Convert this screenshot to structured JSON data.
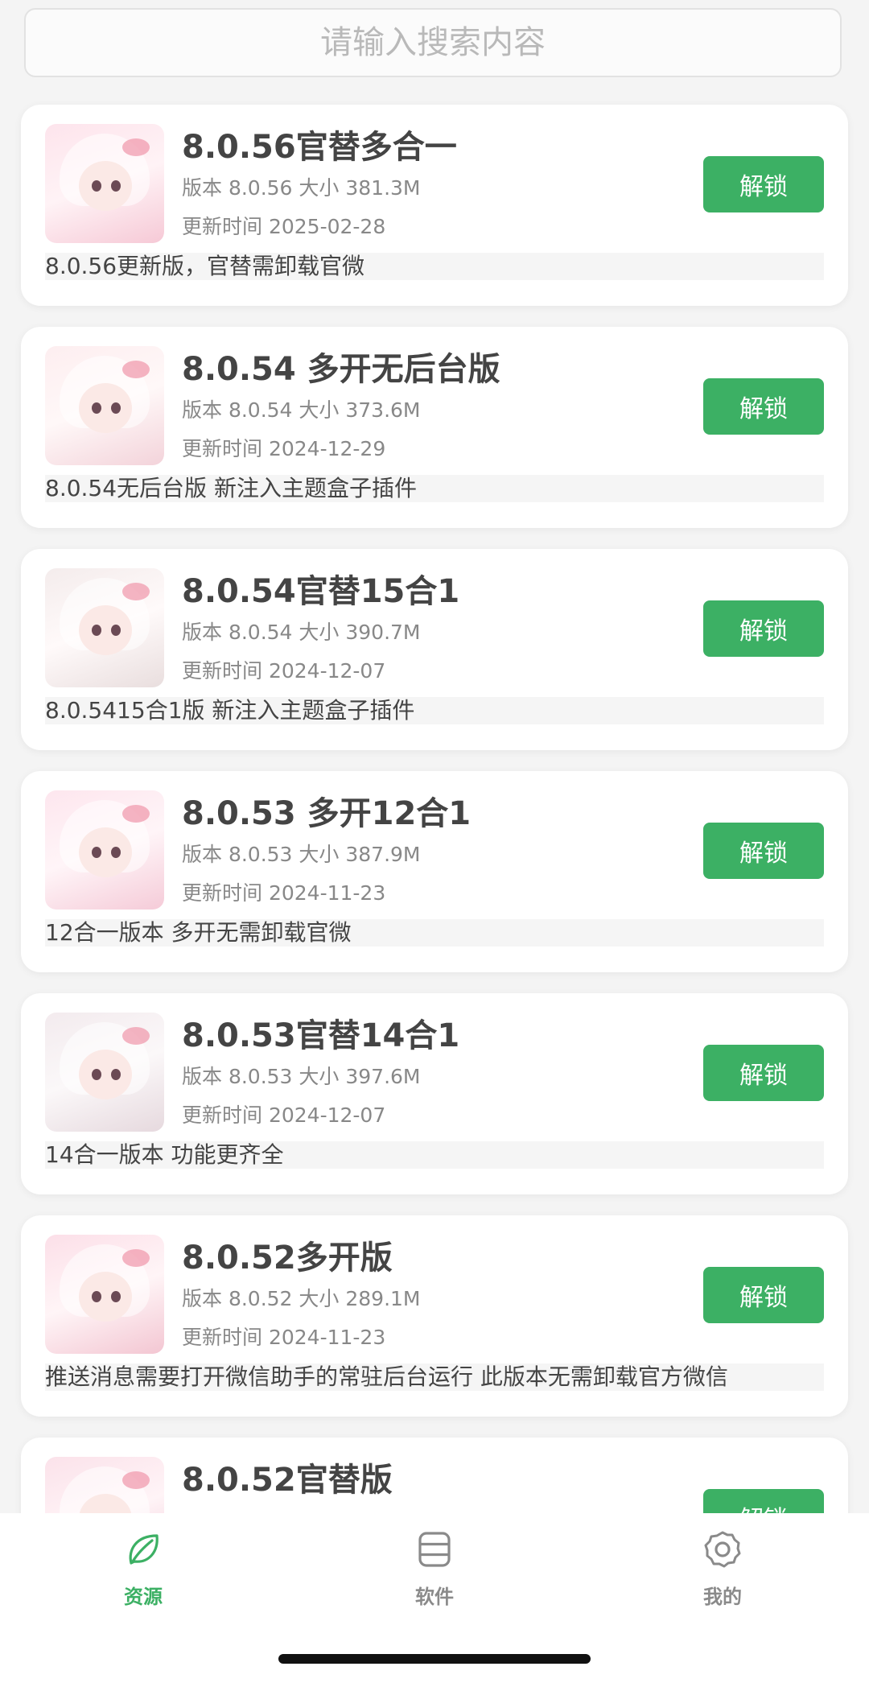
{
  "search": {
    "placeholder": "请输入搜索内容"
  },
  "items": [
    {
      "title": "8.0.56官替多合一",
      "meta": "版本 8.0.56 大小 381.3M",
      "updated": "更新时间 2025-02-28",
      "button": "解锁",
      "desc": "8.0.56更新版，官替需卸载官微"
    },
    {
      "title": "8.0.54 多开无后台版",
      "meta": "版本 8.0.54 大小 373.6M",
      "updated": "更新时间 2024-12-29",
      "button": "解锁",
      "desc": "8.0.54无后台版 新注入主题盒子插件"
    },
    {
      "title": "8.0.54官替15合1",
      "meta": "版本 8.0.54 大小 390.7M",
      "updated": "更新时间 2024-12-07",
      "button": "解锁",
      "desc": "8.0.5415合1版 新注入主题盒子插件"
    },
    {
      "title": "8.0.53 多开12合1",
      "meta": "版本 8.0.53 大小 387.9M",
      "updated": "更新时间 2024-11-23",
      "button": "解锁",
      "desc": "12合一版本 多开无需卸载官微"
    },
    {
      "title": "8.0.53官替14合1",
      "meta": "版本 8.0.53 大小 397.6M",
      "updated": "更新时间 2024-12-07",
      "button": "解锁",
      "desc": "14合一版本 功能更齐全"
    },
    {
      "title": "8.0.52多开版",
      "meta": "版本 8.0.52 大小 289.1M",
      "updated": "更新时间 2024-11-23",
      "button": "解锁",
      "desc": "推送消息需要打开微信助手的常驻后台运行 此版本无需卸载官方微信"
    },
    {
      "title": "8.0.52官替版",
      "meta": "",
      "updated": "",
      "button": "解锁",
      "desc": ""
    }
  ],
  "tabbar": {
    "tabs": [
      {
        "label": "资源",
        "icon": "leaf-icon",
        "active": true
      },
      {
        "label": "软件",
        "icon": "server-stack-icon",
        "active": false
      },
      {
        "label": "我的",
        "icon": "gear-icon",
        "active": false
      }
    ]
  },
  "colors": {
    "accent": "#3cb064",
    "background": "#f4f4f4",
    "inactive": "#8a8a8a"
  }
}
